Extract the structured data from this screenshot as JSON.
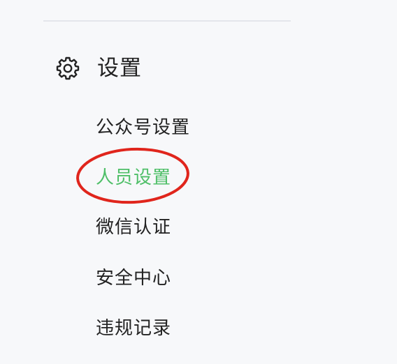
{
  "section": {
    "title": "设置",
    "icon": "gear-icon"
  },
  "menu": {
    "items": [
      {
        "label": "公众号设置",
        "active": false
      },
      {
        "label": "人员设置",
        "active": true
      },
      {
        "label": "微信认证",
        "active": false
      },
      {
        "label": "安全中心",
        "active": false
      },
      {
        "label": "违规记录",
        "active": false
      }
    ]
  },
  "colors": {
    "active_text": "#4fbf68",
    "text": "#222222",
    "background": "#f7f8fa",
    "annotation": "#e0251c"
  }
}
